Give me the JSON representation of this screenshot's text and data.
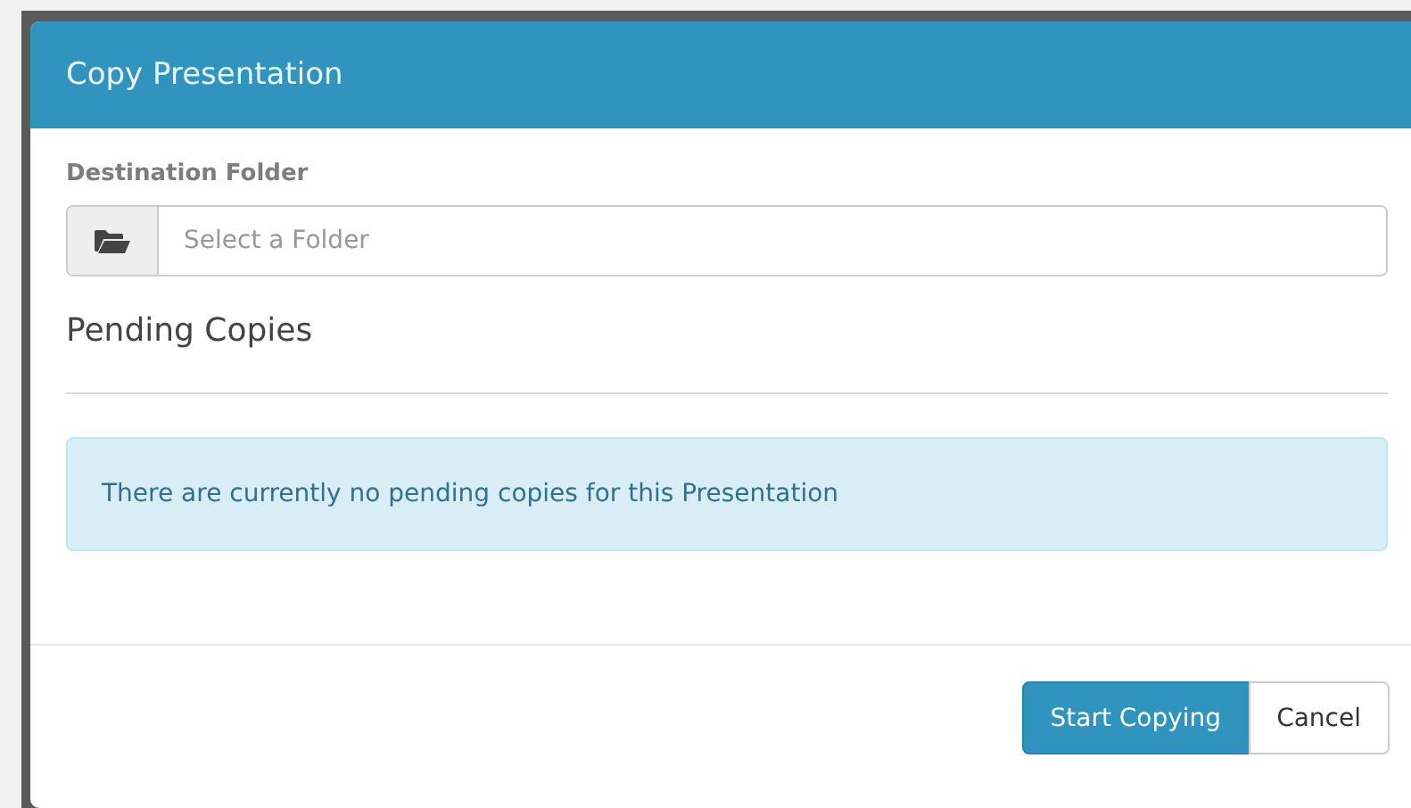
{
  "dialog": {
    "title": "Copy Presentation",
    "destination": {
      "label": "Destination Folder",
      "placeholder": "Select a Folder"
    },
    "pending": {
      "heading": "Pending Copies",
      "message": "There are currently no pending copies for this Presentation"
    },
    "buttons": [
      {
        "label": "Start Copying",
        "kind": "primary"
      },
      {
        "label": "Cancel",
        "kind": "default"
      }
    ]
  }
}
